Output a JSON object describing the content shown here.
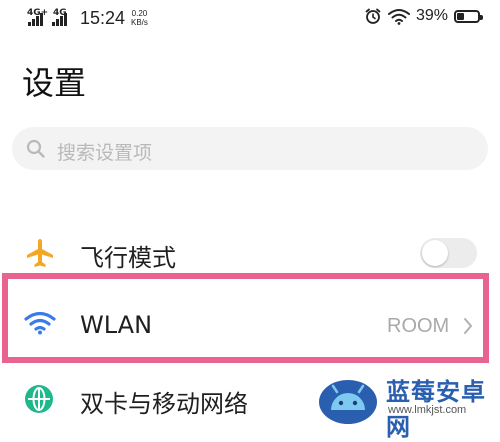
{
  "status_bar": {
    "signal1_label": "4G+",
    "signal2_label": "4G",
    "time": "15:24",
    "speed_value": "0.20",
    "speed_unit": "KB/s",
    "battery_percent": "39%",
    "battery_level": 0.39
  },
  "header": {
    "title": "设置"
  },
  "search": {
    "placeholder": "搜索设置项"
  },
  "settings": {
    "airplane": {
      "label": "飞行模式",
      "enabled": false,
      "icon": "airplane-icon",
      "icon_color": "#f5a623"
    },
    "wlan": {
      "label": "WLAN",
      "value": "ROOM",
      "icon": "wifi-icon",
      "icon_color": "#3a7bea"
    },
    "sim": {
      "label": "双卡与移动网络",
      "icon": "globe-icon",
      "icon_color": "#1fb88a"
    }
  },
  "highlight_color": "#e8638f",
  "watermark": {
    "name": "蓝莓安卓网",
    "url": "www.lmkjst.com"
  }
}
